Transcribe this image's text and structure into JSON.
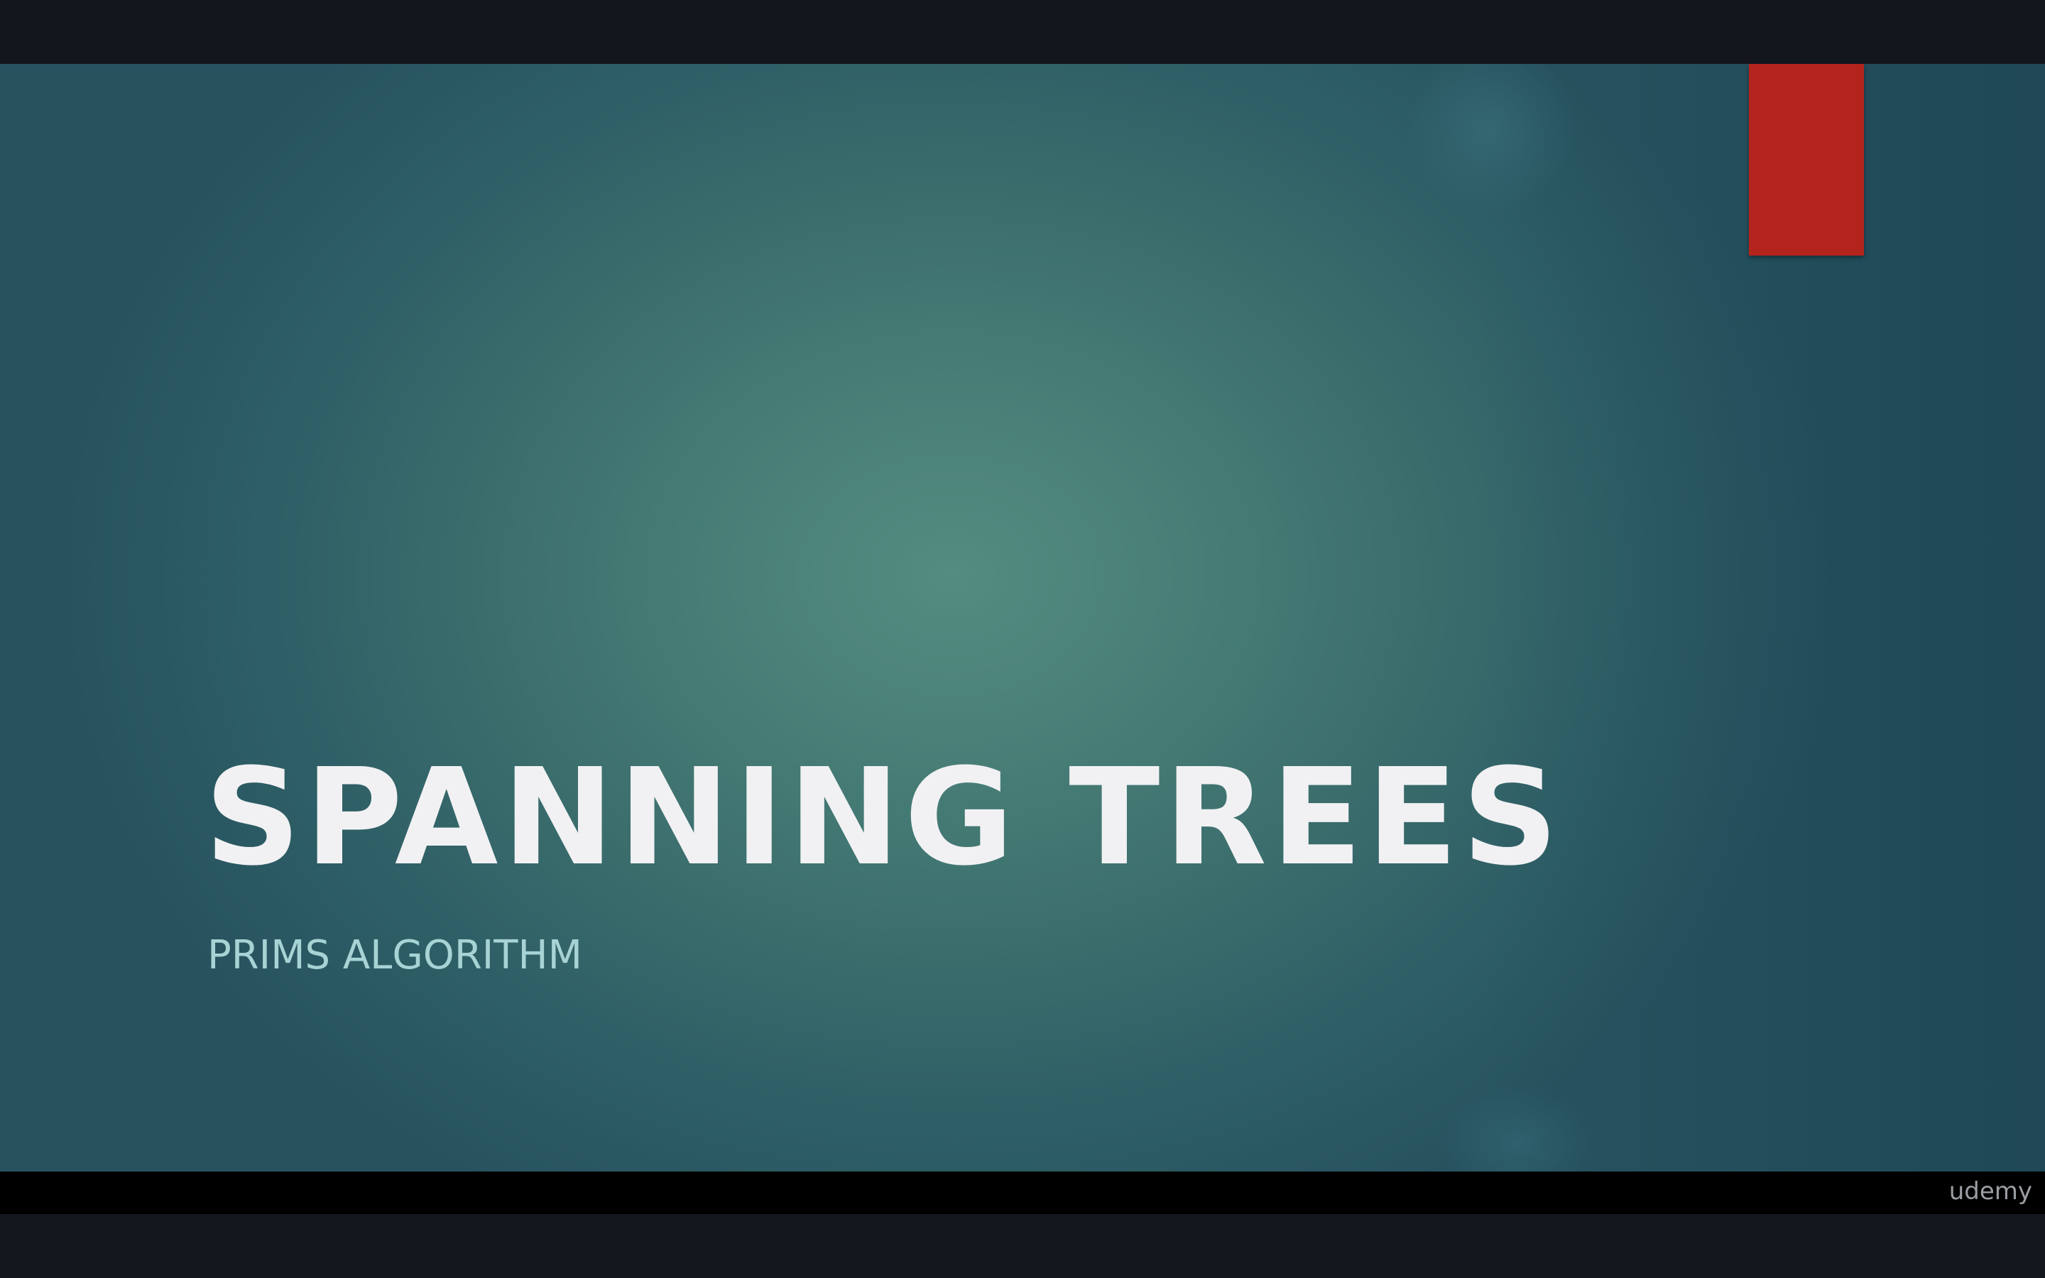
{
  "slide": {
    "title": "SPANNING TREES",
    "subtitle": "PRIMS ALGORITHM"
  },
  "player": {
    "brand": "udemy"
  },
  "colors": {
    "accent_bar": "#b3241d",
    "title_text": "#f1f1f3",
    "subtitle_text": "#a8d3d5",
    "slide_background": "#3a6c6c",
    "letterbox": "#13161d"
  }
}
